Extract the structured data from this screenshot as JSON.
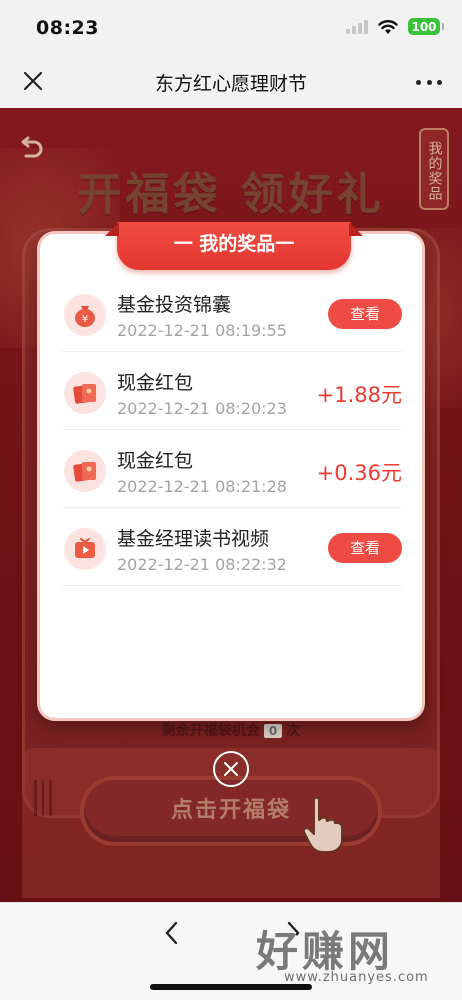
{
  "status_bar": {
    "time": "08:23",
    "battery": "100"
  },
  "nav": {
    "title": "东方红心愿理财节"
  },
  "game": {
    "heading": "开福袋 领好礼",
    "my_prizes_tab": "我的奖品",
    "remaining_prefix": "剩余开福袋机会",
    "remaining_count": "0",
    "remaining_suffix": "次",
    "open_button": "点击开福袋"
  },
  "modal": {
    "title": "一 我的奖品一",
    "prizes": [
      {
        "name": "基金投资锦囊",
        "time": "2022-12-21 08:19:55",
        "action": "查看",
        "icon": "money-bag-icon"
      },
      {
        "name": "现金红包",
        "time": "2022-12-21 08:20:23",
        "amount": "+1.88元",
        "icon": "red-envelope-icon"
      },
      {
        "name": "现金红包",
        "time": "2022-12-21 08:21:28",
        "amount": "+0.36元",
        "icon": "red-envelope-icon"
      },
      {
        "name": "基金经理读书视频",
        "time": "2022-12-21 08:22:32",
        "action": "查看",
        "icon": "video-icon"
      }
    ]
  },
  "watermark": {
    "brand": "好赚网",
    "url": "www.zhuanyes.com"
  },
  "colors": {
    "accent": "#ef4b45",
    "background": "#7a1519",
    "ribbon": "#e3362f"
  }
}
